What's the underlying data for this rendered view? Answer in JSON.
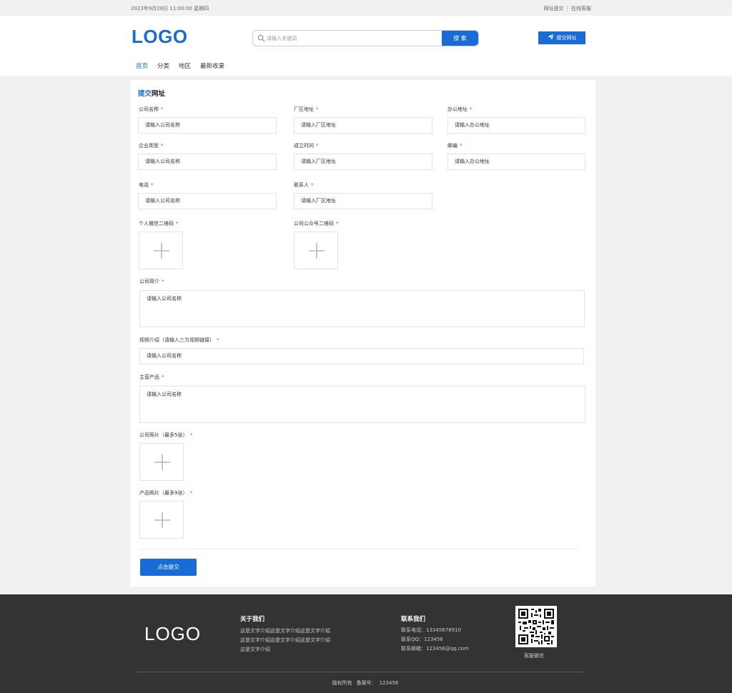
{
  "topbar": {
    "datetime": "2023年9月28日 11:00:00 星期四",
    "link_submit": "网址提交",
    "separator": "|",
    "link_service": "在线客服"
  },
  "header": {
    "logo": "LOGO",
    "search_placeholder": "请输入关键词",
    "search_button": "搜 索",
    "submit_button": "提交网址"
  },
  "nav": {
    "items": [
      "首页",
      "分类",
      "地区",
      "最新收录"
    ],
    "active_index": 0
  },
  "form": {
    "title_highlight": "提交",
    "title_rest": "网址",
    "required_mark": "*",
    "fields": {
      "company_name": {
        "label": "公司名称",
        "placeholder": "请输入公司名称"
      },
      "factory_address": {
        "label": "厂区地址",
        "placeholder": "请输入厂区地址"
      },
      "office_address": {
        "label": "办公地址",
        "placeholder": "请输入办公地址"
      },
      "company_type": {
        "label": "企业类型",
        "placeholder": "请输入公司名称"
      },
      "founded": {
        "label": "成立时间",
        "placeholder": "请输入厂区地址"
      },
      "zipcode": {
        "label": "邮编",
        "placeholder": "请输入办公地址"
      },
      "phone": {
        "label": "电话",
        "placeholder": "请输入公司名称"
      },
      "contact": {
        "label": "联系人",
        "placeholder": "请输入厂区地址"
      },
      "wechat_qr": {
        "label": "个人微信二维码"
      },
      "official_qr": {
        "label": "公司公众号二维码"
      },
      "intro": {
        "label": "公司简介",
        "placeholder": "请输入公司名称"
      },
      "video": {
        "label": "视频介绍（请输入三方视频链接）",
        "placeholder": "请输入公司名称"
      },
      "products": {
        "label": "主营产品",
        "placeholder": "请输入公司名称"
      },
      "company_photos": {
        "label": "公司照片（最多5张）"
      },
      "product_photos": {
        "label": "产品照片（最多9张）"
      }
    },
    "submit_label": "点击提交"
  },
  "footer": {
    "logo": "LOGO",
    "about_title": "关于我们",
    "about_text": "这是文字介绍这是文字介绍这是文字介绍这是文字介绍这是文字介绍这是文字介绍这是文字介绍",
    "contact_title": "联系我们",
    "phone_label": "联系电话：",
    "phone": "13345678910",
    "qq_label": "联系QQ：",
    "qq": "123456",
    "email_label": "联系邮箱：",
    "email": "123456@qq.com",
    "qr_caption": "客服微信",
    "copyright": "版权所有",
    "icp_label": "备案号：",
    "icp": "123456"
  },
  "colors": {
    "primary": "#1a6bd6",
    "required": "#e23b3b",
    "footer_bg": "#333333",
    "page_bg": "#f1f1f1"
  },
  "icons": {
    "search": "search-icon",
    "submit": "paper-plane-icon",
    "upload": "plus-icon",
    "qr": "qr-code-icon"
  }
}
